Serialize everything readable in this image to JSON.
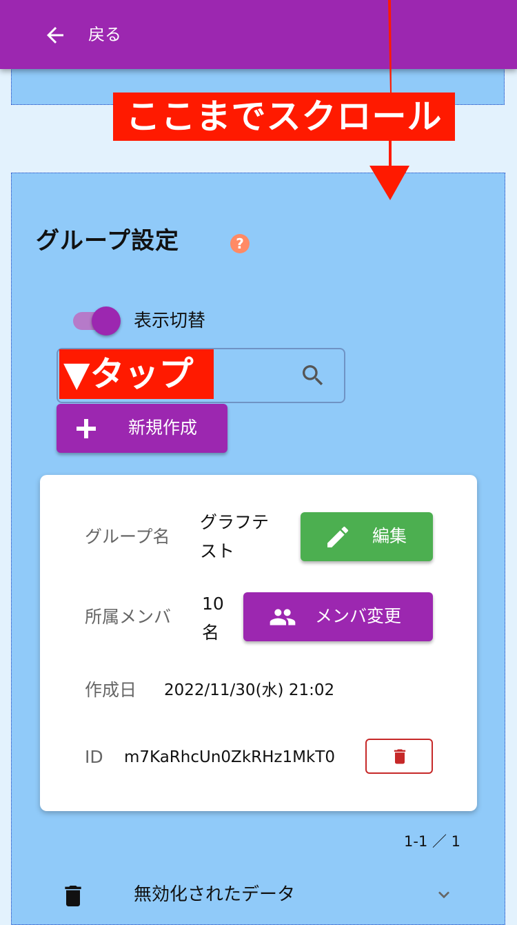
{
  "header": {
    "back_label": "戻る"
  },
  "annotations": {
    "scroll_here": "ここまでスクロール",
    "tap": "▼タップ",
    "color": "#ff1a00"
  },
  "section": {
    "title": "グループ設定",
    "help_icon": "?",
    "toggle_label": "表示切替",
    "toggle_on": true,
    "create_button": "新規作成"
  },
  "group_card": {
    "name_label": "グループ名",
    "name_line1": "グラフテ",
    "name_line2": "スト",
    "edit_button": "編集",
    "members_label": "所属メンバ",
    "members_count": "10",
    "members_unit": "名",
    "member_change_button": "メンバ変更",
    "created_label": "作成日",
    "created_value": "2022/11/30(水) 21:02",
    "id_label": "ID",
    "id_value": "m7KaRhcUn0ZkRHz1MkT0"
  },
  "pagination": "1-1 ／ 1",
  "disabled_data_label": "無効化されたデータ",
  "colors": {
    "primary": "#9c27b0",
    "success": "#4caf50",
    "danger": "#c62828",
    "section_bg": "#90caf9",
    "page_bg": "#e3f2fd"
  }
}
